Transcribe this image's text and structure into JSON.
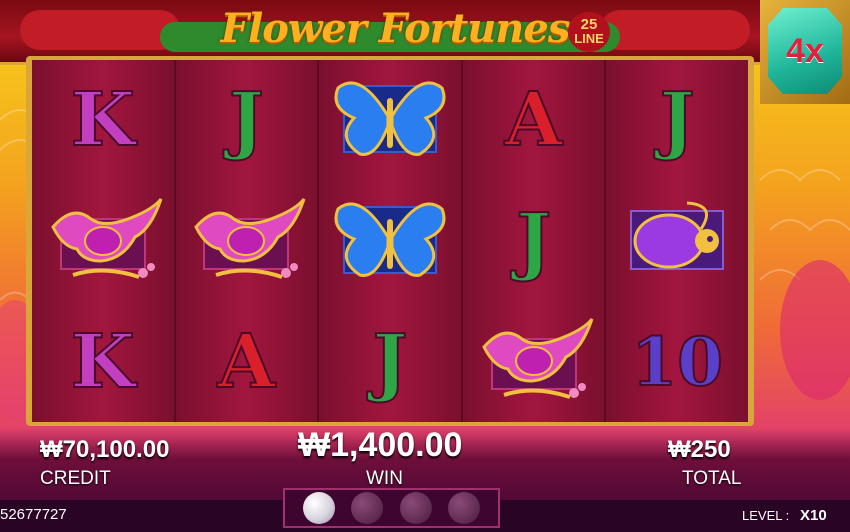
{
  "header": {
    "title": "Flower Fortunes",
    "line_badge_number": "25",
    "line_badge_text": "LINE",
    "multiplier": "4x"
  },
  "reels": [
    [
      "K",
      "phoenix",
      "K"
    ],
    [
      "J",
      "phoenix",
      "A"
    ],
    [
      "butterfly",
      "butterfly",
      "J"
    ],
    [
      "A",
      "J",
      "phoenix"
    ],
    [
      "J",
      "scarab",
      "10"
    ]
  ],
  "footer": {
    "credit_value": "₩70,100.00",
    "credit_label": "CREDIT",
    "win_value": "₩1,400.00",
    "win_label": "WIN",
    "total_value": "₩250",
    "total_label": "TOTAL",
    "account_id": "52677727",
    "level_label": "LEVEL :",
    "level_value": "X10",
    "pearls_total": 4,
    "pearls_active": 1
  },
  "colors": {
    "K": "#c23fc0",
    "J": "#2fa645",
    "A": "#d9202a",
    "ten": "#5a3fc8",
    "multiplier_gem": "#1fb59a"
  }
}
